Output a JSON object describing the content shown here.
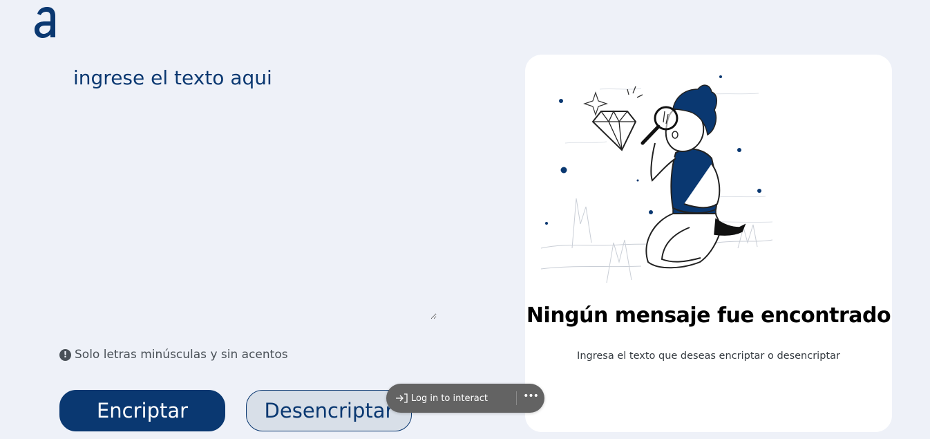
{
  "brand": {
    "logo_icon": "logo-a-icon",
    "color": "#0a3871"
  },
  "input": {
    "placeholder": "ingrese el texto aqui",
    "value": ""
  },
  "hint": {
    "icon": "info-icon",
    "text": "Solo letras minúsculas y sin acentos"
  },
  "buttons": {
    "encrypt_label": "Encriptar",
    "decrypt_label": "Desencriptar"
  },
  "output": {
    "illustration": "person-searching-with-magnifier-illustration",
    "title": "Ningún mensaje fue encontrado",
    "subtitle": "Ingresa el texto que deseas encriptar o desencriptar"
  },
  "overlay": {
    "login_label": "Log in to interact",
    "login_icon": "login-arrow-icon",
    "more_icon": "more-dots-icon"
  },
  "colors": {
    "background": "#eef1f8",
    "primary": "#0a3871",
    "panel": "#ffffff",
    "overlay": "#636363"
  }
}
